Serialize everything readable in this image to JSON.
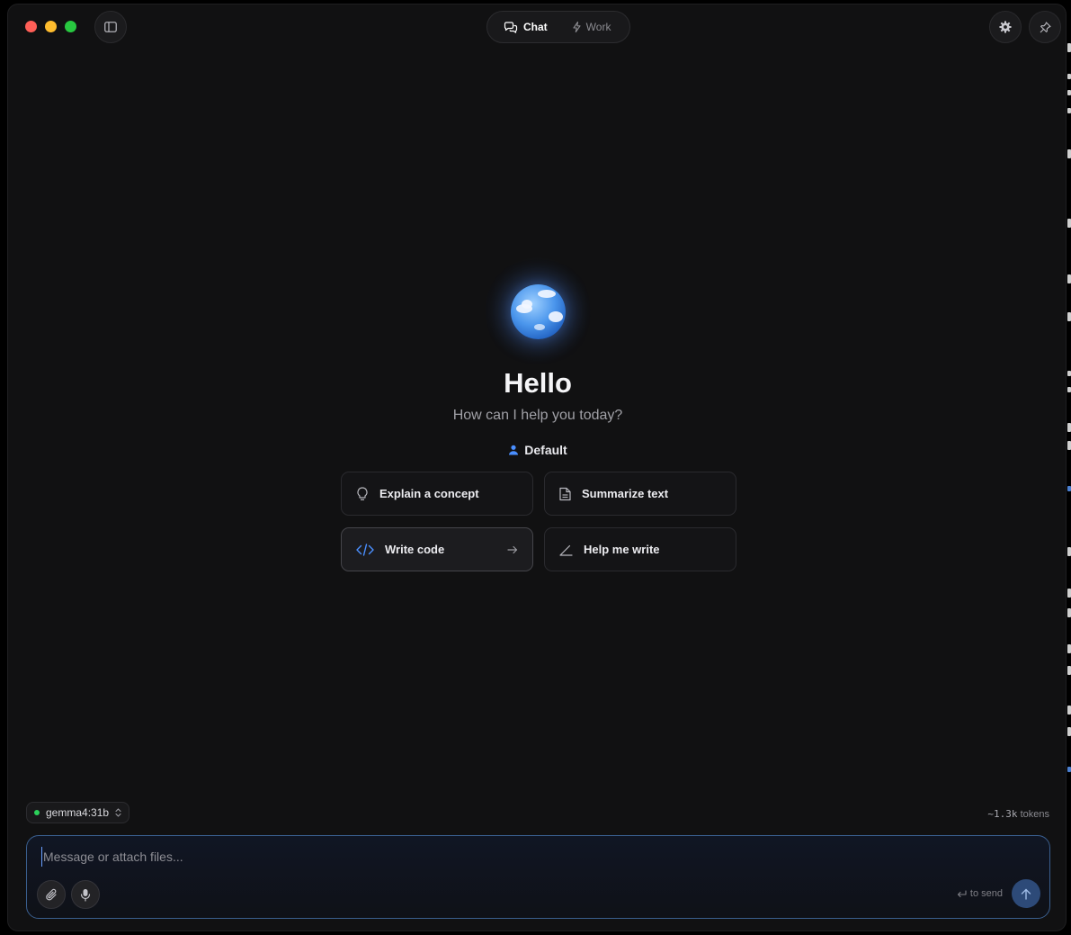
{
  "header": {
    "modes": [
      {
        "label": "Chat",
        "icon": "chat-bubbles-icon",
        "active": true
      },
      {
        "label": "Work",
        "icon": "lightning-icon",
        "active": false
      }
    ]
  },
  "hero": {
    "title": "Hello",
    "subtitle": "How can I help you today?",
    "persona": "Default"
  },
  "suggestions": [
    {
      "label": "Explain a concept",
      "icon": "lightbulb-icon"
    },
    {
      "label": "Summarize text",
      "icon": "document-icon"
    },
    {
      "label": "Write code",
      "icon": "code-icon"
    },
    {
      "label": "Help me write",
      "icon": "pen-icon"
    }
  ],
  "model": {
    "name": "gemma4:31b",
    "status_color": "#2bd15a"
  },
  "tokens": {
    "count": "~1.3k",
    "unit": "tokens"
  },
  "composer": {
    "placeholder": "Message or attach files...",
    "value": "",
    "send_hint": "to send"
  },
  "colors": {
    "accent": "#4a8fff",
    "background": "#111112"
  }
}
